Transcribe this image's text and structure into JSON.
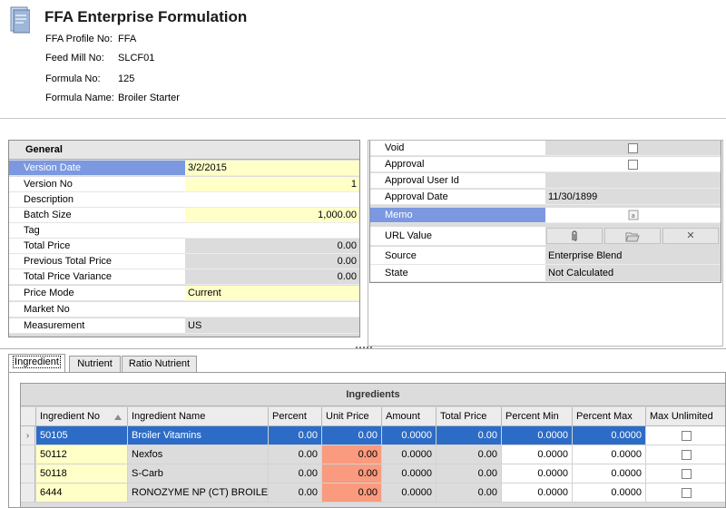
{
  "header": {
    "title": "FFA Enterprise Formulation",
    "fields": [
      {
        "label": "FFA Profile No:",
        "value": "FFA"
      },
      {
        "label": "Feed Mill No:",
        "value": "SLCF01"
      },
      {
        "label": "Formula No:",
        "value": "125"
      },
      {
        "label": "Formula Name:",
        "value": "Broiler Starter"
      }
    ]
  },
  "general": {
    "title": "General",
    "rows": [
      {
        "label": "Version Date",
        "value": "3/2/2015"
      },
      {
        "label": "Version No",
        "value": "1"
      },
      {
        "label": "Description",
        "value": ""
      },
      {
        "label": "Batch Size",
        "value": "1,000.00"
      },
      {
        "label": "Tag",
        "value": ""
      },
      {
        "label": "Total Price",
        "value": "0.00"
      },
      {
        "label": "Previous Total Price",
        "value": "0.00"
      },
      {
        "label": "Total Price Variance",
        "value": "0.00"
      },
      {
        "label": "Price Mode",
        "value": "Current"
      },
      {
        "label": "Market No",
        "value": ""
      },
      {
        "label": "Measurement",
        "value": "US"
      }
    ]
  },
  "approval": {
    "rows": [
      {
        "label": "Void",
        "value": ""
      },
      {
        "label": "Approval",
        "value": ""
      },
      {
        "label": "Approval User Id",
        "value": ""
      },
      {
        "label": "Approval Date",
        "value": "11/30/1899"
      },
      {
        "label": "Memo",
        "value": ""
      },
      {
        "label": "URL Value",
        "value": ""
      },
      {
        "label": "Source",
        "value": "Enterprise Blend"
      },
      {
        "label": "State",
        "value": "Not Calculated"
      }
    ],
    "void_checked": false,
    "approval_checked": false,
    "url_clear_glyph": "✕"
  },
  "tabs": [
    {
      "label": "Ingredient",
      "active": true
    },
    {
      "label": "Nutrient",
      "active": false
    },
    {
      "label": "Ratio Nutrient",
      "active": false
    }
  ],
  "ingredients": {
    "caption": "Ingredients",
    "columns": [
      "Ingredient No",
      "Ingredient Name",
      "Percent",
      "Unit Price",
      "Amount",
      "Total Price",
      "Percent Min",
      "Percent Max",
      "Max Unlimited"
    ],
    "rows": [
      {
        "no": "50105",
        "name": "Broiler Vitamins",
        "percent": "0.00",
        "unit_price": "0.00",
        "amount": "0.0000",
        "total_price": "0.00",
        "pmin": "0.0000",
        "pmax": "0.0000",
        "max_unlimited": false,
        "selected": true
      },
      {
        "no": "50112",
        "name": "Nexfos",
        "percent": "0.00",
        "unit_price": "0.00",
        "amount": "0.0000",
        "total_price": "0.00",
        "pmin": "0.0000",
        "pmax": "0.0000",
        "max_unlimited": false,
        "selected": false
      },
      {
        "no": "50118",
        "name": "S-Carb",
        "percent": "0.00",
        "unit_price": "0.00",
        "amount": "0.0000",
        "total_price": "0.00",
        "pmin": "0.0000",
        "pmax": "0.0000",
        "max_unlimited": false,
        "selected": false
      },
      {
        "no": "6444",
        "name": "RONOZYME NP (CT) BROILERS",
        "percent": "0.00",
        "unit_price": "0.00",
        "amount": "0.0000",
        "total_price": "0.00",
        "pmin": "0.0000",
        "pmax": "0.0000",
        "max_unlimited": false,
        "selected": false
      }
    ]
  },
  "colors": {
    "selection": "#7b98e0",
    "grid_selection": "#2d6cc6",
    "editable": "#ffffc8",
    "readonly": "#dcdcdc",
    "price_highlight": "#fa9a7e"
  }
}
